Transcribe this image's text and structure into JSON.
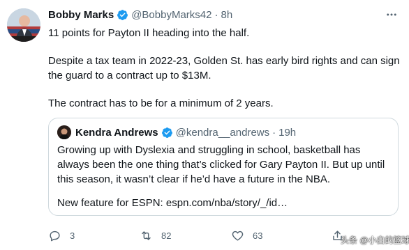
{
  "tweet": {
    "author_name": "Bobby Marks",
    "author_handle": "@BobbyMarks42",
    "separator": "·",
    "time": "8h",
    "paragraphs": [
      "11 points for Payton II heading into the half.",
      "Despite a tax team in 2022-23, Golden St. has early bird rights and can sign the guard to a contract up to $13M.",
      "The contract has to be for a minimum of 2 years."
    ]
  },
  "quoted_tweet": {
    "author_name": "Kendra Andrews",
    "author_handle": "@kendra__andrews",
    "separator": "·",
    "time": "19h",
    "paragraphs": [
      "Growing up with Dyslexia and struggling in school, basketball has always been the one thing that’s clicked for Gary Payton II. But up until this season, it wasn’t clear if he’d have a future in the NBA.",
      "New feature for ESPN: espn.com/nba/story/_/id…"
    ]
  },
  "actions": {
    "reply_count": "3",
    "retweet_count": "82",
    "like_count": "63"
  },
  "watermark": "头条 @小白的篮球梦",
  "colors": {
    "verified": "#1d9bf0",
    "secondary_text": "#536471",
    "border": "#cfd9de"
  }
}
